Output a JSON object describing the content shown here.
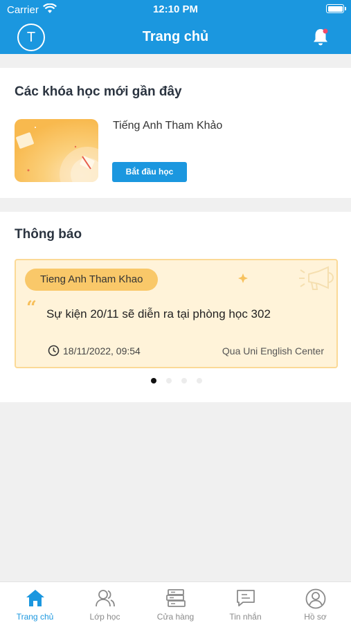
{
  "status_bar": {
    "carrier": "Carrier",
    "time": "12:10 PM"
  },
  "header": {
    "avatar_initial": "T",
    "title": "Trang chủ"
  },
  "recent_courses": {
    "title": "Các khóa học mới gần đây",
    "items": [
      {
        "name": "Tiếng Anh Tham Khảo",
        "action_label": "Bắt đầu học"
      }
    ]
  },
  "notifications": {
    "title": "Thông báo",
    "items": [
      {
        "tag": "Tieng Anh Tham Khao",
        "message": "Sự kiện 20/11 sẽ diễn ra tại phòng học 302",
        "datetime": "18/11/2022, 09:54",
        "source": "Qua Uni English Center"
      }
    ],
    "pagination": {
      "count": 4,
      "active": 1
    }
  },
  "tabbar": {
    "items": [
      {
        "label": "Trang chủ",
        "icon": "home-icon",
        "active": true
      },
      {
        "label": "Lớp học",
        "icon": "users-icon",
        "active": false
      },
      {
        "label": "Cửa hàng",
        "icon": "books-icon",
        "active": false
      },
      {
        "label": "Tin nhắn",
        "icon": "message-icon",
        "active": false
      },
      {
        "label": "Hồ sơ",
        "icon": "profile-icon",
        "active": false
      }
    ]
  },
  "colors": {
    "primary": "#1b97df",
    "background": "#f0f0f0",
    "notice_bg": "#fff3d9",
    "notice_tag": "#f9c869"
  }
}
